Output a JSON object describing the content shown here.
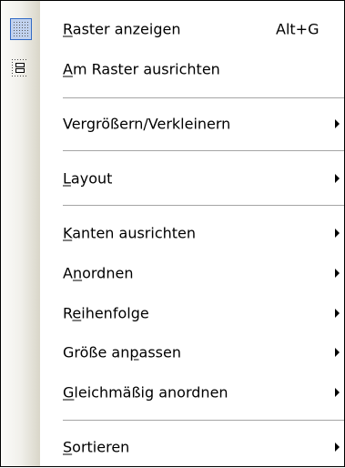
{
  "menu": {
    "items": [
      {
        "pre": "",
        "ul": "R",
        "post": "aster anzeigen",
        "shortcut": "Alt+G"
      },
      {
        "pre": "",
        "ul": "A",
        "post": "m Raster ausrichten"
      },
      {
        "pre": "Vergrößern/Verkleinern",
        "ul": "",
        "post": ""
      },
      {
        "pre": "",
        "ul": "L",
        "post": "ayout"
      },
      {
        "pre": "",
        "ul": "K",
        "post": "anten ausrichten"
      },
      {
        "pre": "A",
        "ul": "n",
        "post": "ordnen"
      },
      {
        "pre": "R",
        "ul": "e",
        "post": "ihenfolge"
      },
      {
        "pre": "Größe an",
        "ul": "p",
        "post": "assen"
      },
      {
        "pre": "",
        "ul": "G",
        "post": "leichmäßig anordnen"
      },
      {
        "pre": "",
        "ul": "S",
        "post": "ortieren"
      }
    ]
  },
  "icons": {
    "grid": "grid-icon",
    "align_to_grid": "align-to-grid-icon",
    "submenu": "submenu-arrow-icon"
  }
}
